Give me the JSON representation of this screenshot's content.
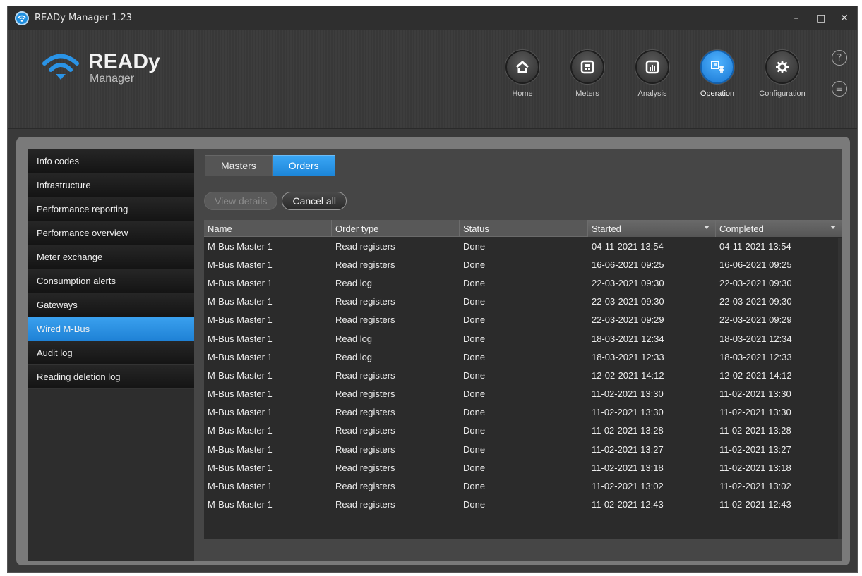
{
  "window": {
    "title": "READy Manager 1.23"
  },
  "logo": {
    "brand": "READy",
    "sub": "Manager"
  },
  "nav": [
    {
      "label": "Home",
      "icon": "home-icon"
    },
    {
      "label": "Meters",
      "icon": "meter-icon"
    },
    {
      "label": "Analysis",
      "icon": "chart-icon"
    },
    {
      "label": "Operation",
      "icon": "operation-icon",
      "active": true
    },
    {
      "label": "Configuration",
      "icon": "gear-icon"
    }
  ],
  "help": {
    "help_glyph": "?",
    "chat_glyph": "≡"
  },
  "sidebar": {
    "items": [
      {
        "label": "Info codes"
      },
      {
        "label": "Infrastructure"
      },
      {
        "label": "Performance reporting"
      },
      {
        "label": "Performance overview"
      },
      {
        "label": "Meter exchange"
      },
      {
        "label": "Consumption alerts"
      },
      {
        "label": "Gateways"
      },
      {
        "label": "Wired M-Bus",
        "active": true
      },
      {
        "label": "Audit log"
      },
      {
        "label": "Reading deletion log"
      }
    ]
  },
  "tabs": [
    {
      "label": "Masters"
    },
    {
      "label": "Orders",
      "active": true
    }
  ],
  "toolbar": {
    "view_details_label": "View details",
    "cancel_all_label": "Cancel all"
  },
  "table": {
    "columns": [
      "Name",
      "Order type",
      "Status",
      "Started",
      "Completed"
    ],
    "rows": [
      [
        "M-Bus Master 1",
        "Read registers",
        "Done",
        "04-11-2021 13:54",
        "04-11-2021 13:54"
      ],
      [
        "M-Bus Master 1",
        "Read registers",
        "Done",
        "16-06-2021 09:25",
        "16-06-2021 09:25"
      ],
      [
        "M-Bus Master 1",
        "Read log",
        "Done",
        "22-03-2021 09:30",
        "22-03-2021 09:30"
      ],
      [
        "M-Bus Master 1",
        "Read registers",
        "Done",
        "22-03-2021 09:30",
        "22-03-2021 09:30"
      ],
      [
        "M-Bus Master 1",
        "Read registers",
        "Done",
        "22-03-2021 09:29",
        "22-03-2021 09:29"
      ],
      [
        "M-Bus Master 1",
        "Read log",
        "Done",
        "18-03-2021 12:34",
        "18-03-2021 12:34"
      ],
      [
        "M-Bus Master 1",
        "Read log",
        "Done",
        "18-03-2021 12:33",
        "18-03-2021 12:33"
      ],
      [
        "M-Bus Master 1",
        "Read registers",
        "Done",
        "12-02-2021 14:12",
        "12-02-2021 14:12"
      ],
      [
        "M-Bus Master 1",
        "Read registers",
        "Done",
        "11-02-2021 13:30",
        "11-02-2021 13:30"
      ],
      [
        "M-Bus Master 1",
        "Read registers",
        "Done",
        "11-02-2021 13:30",
        "11-02-2021 13:30"
      ],
      [
        "M-Bus Master 1",
        "Read registers",
        "Done",
        "11-02-2021 13:28",
        "11-02-2021 13:28"
      ],
      [
        "M-Bus Master 1",
        "Read registers",
        "Done",
        "11-02-2021 13:27",
        "11-02-2021 13:27"
      ],
      [
        "M-Bus Master 1",
        "Read registers",
        "Done",
        "11-02-2021 13:18",
        "11-02-2021 13:18"
      ],
      [
        "M-Bus Master 1",
        "Read registers",
        "Done",
        "11-02-2021 13:02",
        "11-02-2021 13:02"
      ],
      [
        "M-Bus Master 1",
        "Read registers",
        "Done",
        "11-02-2021 12:43",
        "11-02-2021 12:43"
      ]
    ]
  },
  "colors": {
    "accent": "#2a93e6",
    "background": "#3a3a3a"
  }
}
